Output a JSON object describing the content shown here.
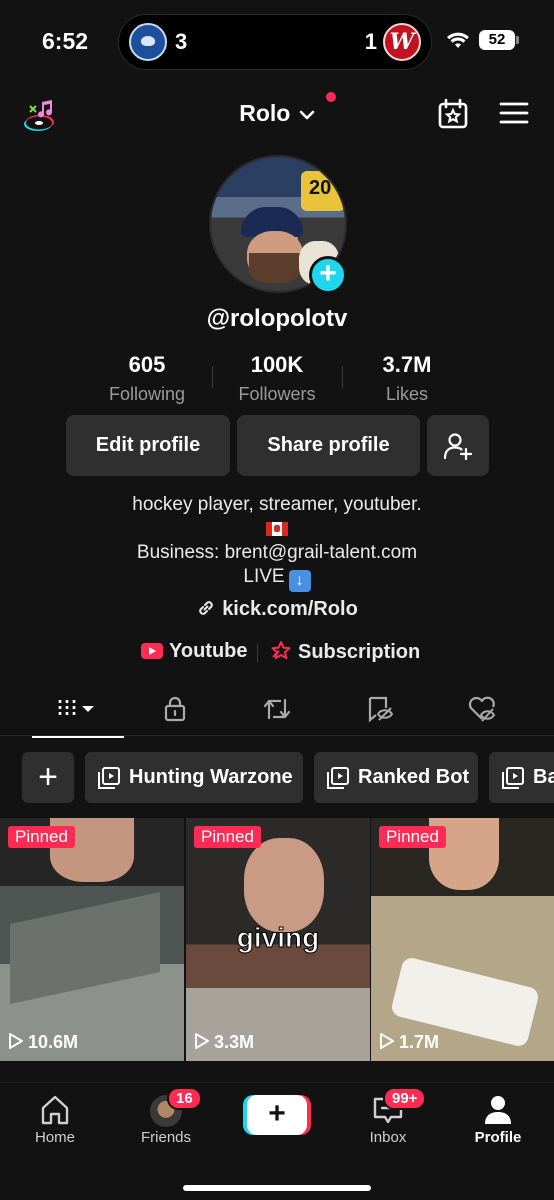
{
  "status_bar": {
    "time": "6:52",
    "score_left": "3",
    "score_right": "1",
    "battery": "52",
    "nats_letter": "W"
  },
  "header": {
    "username": "Rolo"
  },
  "profile": {
    "handle": "@rolopolotv",
    "avatar_jersey_number": "20",
    "stats": [
      {
        "value": "605",
        "label": "Following"
      },
      {
        "value": "100K",
        "label": "Followers"
      },
      {
        "value": "3.7M",
        "label": "Likes"
      }
    ],
    "buttons": {
      "edit": "Edit profile",
      "share": "Share profile"
    },
    "bio": {
      "line1": "hockey player, streamer, youtuber.",
      "line3": "Business: brent@grail-talent.com",
      "line4": "LIVE"
    },
    "link": "kick.com/Rolo",
    "socials": {
      "youtube": "Youtube",
      "subscription": "Subscription"
    }
  },
  "collections": {
    "items": [
      "Hunting Warzone",
      "Ranked Bot",
      "Ba"
    ]
  },
  "videos": [
    {
      "pinned": "Pinned",
      "views": "10.6M",
      "caption": ""
    },
    {
      "pinned": "Pinned",
      "views": "3.3M",
      "caption": "giving"
    },
    {
      "pinned": "Pinned",
      "views": "1.7M",
      "caption": ""
    }
  ],
  "bottom_nav": {
    "home": "Home",
    "friends": "Friends",
    "friends_badge": "16",
    "inbox": "Inbox",
    "inbox_badge": "99+",
    "profile": "Profile",
    "create": "+"
  },
  "colors": {
    "accent_red": "#fe2c55",
    "accent_cyan": "#20d5ec",
    "background": "#121212",
    "button_bg": "#2f2f2f"
  }
}
